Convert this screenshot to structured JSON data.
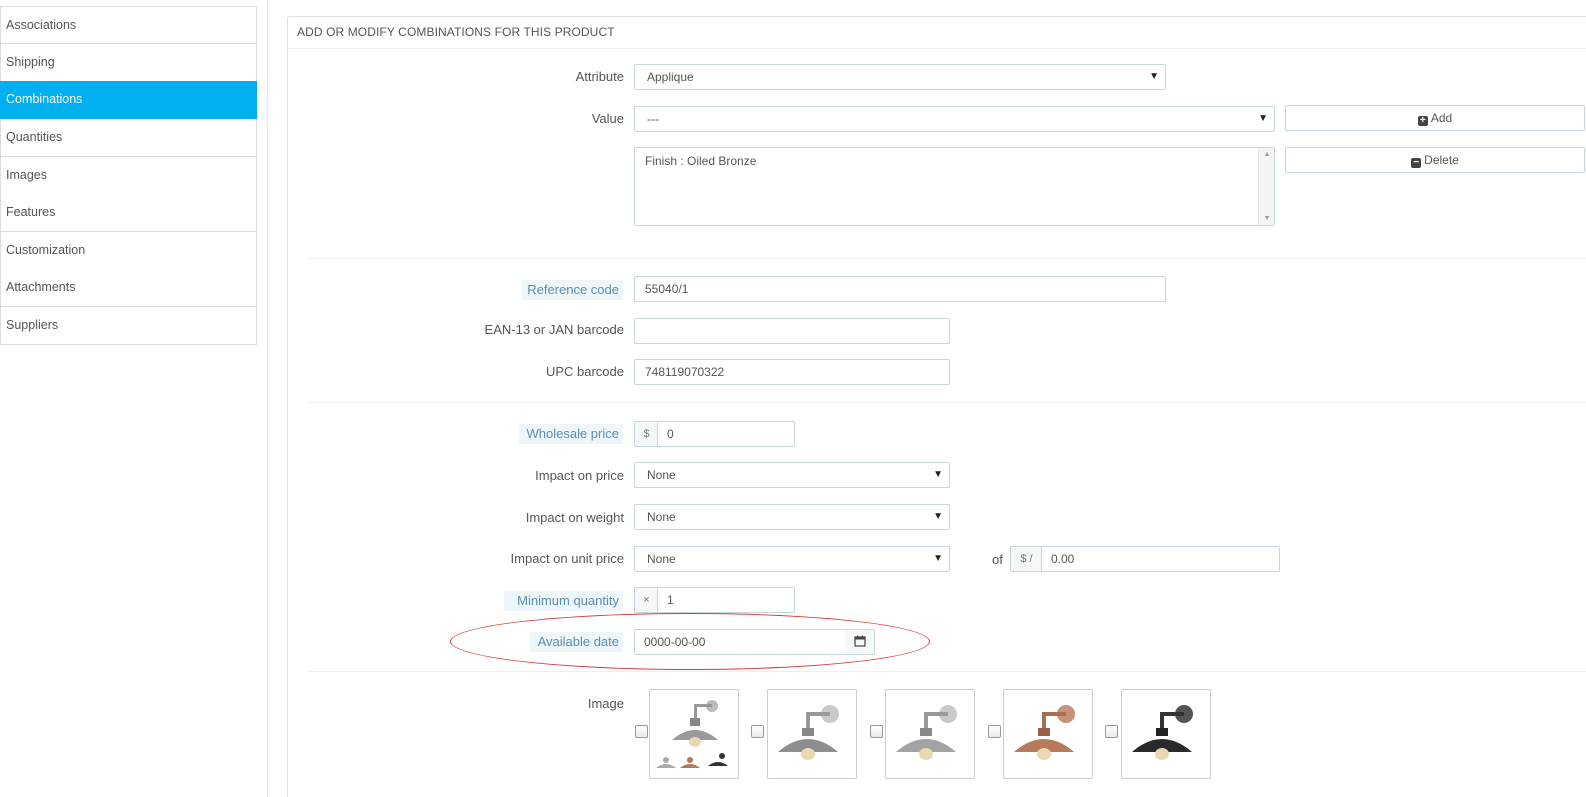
{
  "sidebar": {
    "items": [
      {
        "label": "Associations",
        "active": false
      },
      {
        "label": "Shipping",
        "active": false
      },
      {
        "label": "Combinations",
        "active": true
      },
      {
        "label": "Quantities",
        "active": false
      },
      {
        "label": "Images",
        "active": false
      },
      {
        "label": "Features",
        "active": false
      },
      {
        "label": "Customization",
        "active": false
      },
      {
        "label": "Attachments",
        "active": false
      },
      {
        "label": "Suppliers",
        "active": false
      }
    ]
  },
  "panel": {
    "title": "ADD OR MODIFY COMBINATIONS FOR THIS PRODUCT"
  },
  "form": {
    "attribute_label": "Attribute",
    "attribute_value": "Applique",
    "value_label": "Value",
    "value_value": "---",
    "add_label": "Add",
    "delete_label": "Delete",
    "combination_list": [
      "Finish : Oiled Bronze"
    ],
    "reference_label": "Reference code",
    "reference_value": "55040/1",
    "ean_label": "EAN-13 or JAN barcode",
    "ean_value": "",
    "upc_label": "UPC barcode",
    "upc_value": "748119070322",
    "wholesale_label": "Wholesale price",
    "wholesale_currency": "$",
    "wholesale_value": "0",
    "impact_price_label": "Impact on price",
    "impact_price_value": "None",
    "impact_weight_label": "Impact on weight",
    "impact_weight_value": "None",
    "impact_unit_label": "Impact on unit price",
    "impact_unit_value": "None",
    "of_label": "of",
    "unit_currency": "$ /",
    "unit_value": "0.00",
    "min_qty_label": "Minimum quantity",
    "min_qty_prefix": "×",
    "min_qty_value": "1",
    "available_date_label": "Available date",
    "available_date_value": "0000-00-00",
    "image_label": "Image"
  },
  "colors": {
    "accent": "#00aff0",
    "annotation": "#d23a3a"
  },
  "icons": {
    "add": "plus-square-icon",
    "delete": "minus-square-icon",
    "calendar": "calendar-icon"
  }
}
